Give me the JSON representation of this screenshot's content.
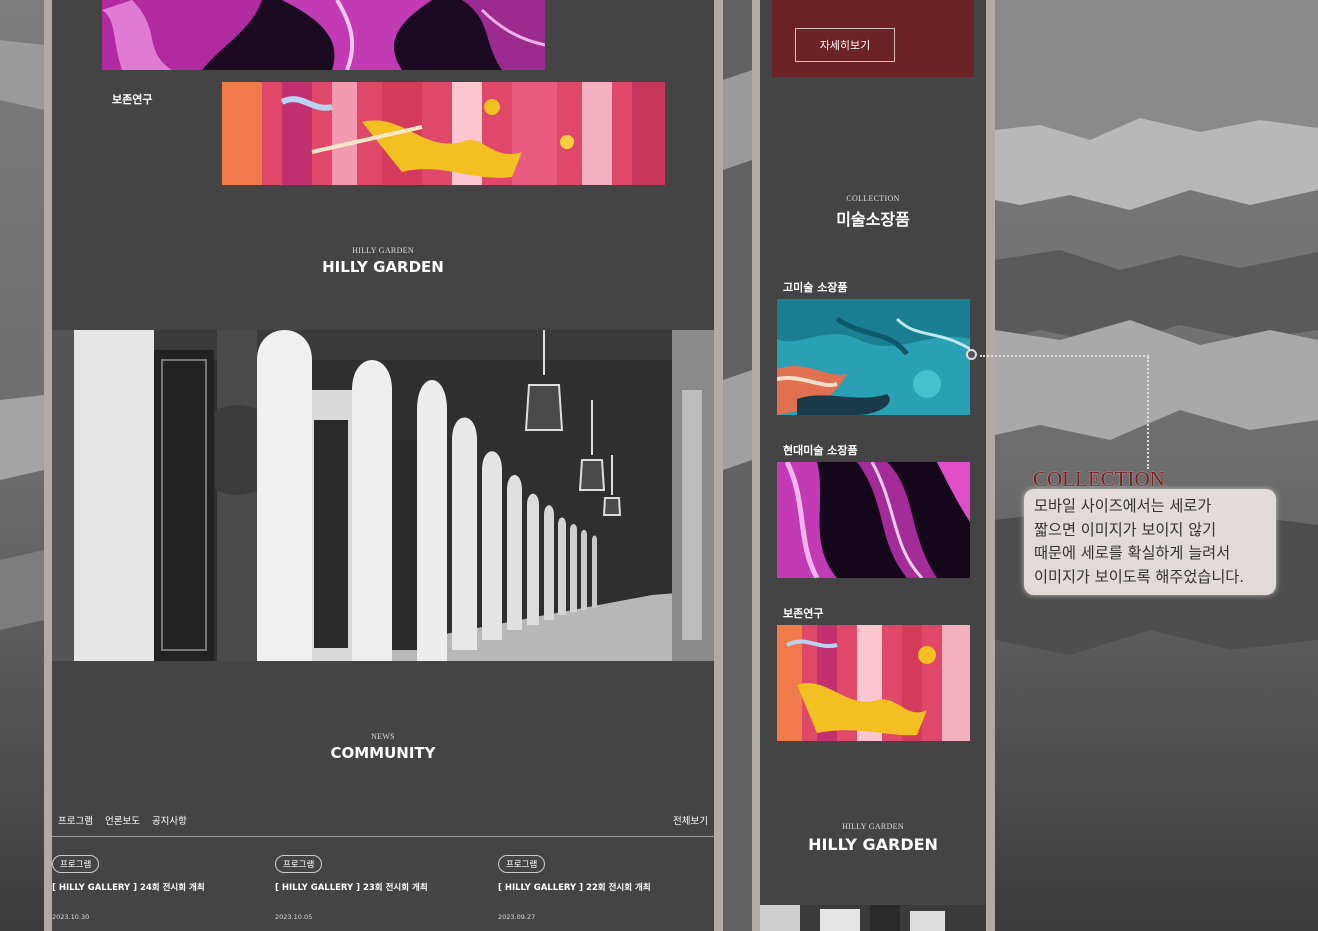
{
  "desktop": {
    "section_label_research": "보존연구",
    "hilly": {
      "eyebrow": "HILLY GARDEN",
      "title": "HILLY GARDEN"
    },
    "community": {
      "eyebrow": "NEWS",
      "title": "COMMUNITY"
    },
    "tabs": [
      "프로그램",
      "언론보도",
      "공지사항"
    ],
    "view_all": "전체보기",
    "news": [
      {
        "badge": "프로그램",
        "title": "[ HILLY GALLERY ] 24회 전시회 개최",
        "date": "2023.10.30"
      },
      {
        "badge": "프로그램",
        "title": "[ HILLY GALLERY ] 23회 전시회 개최",
        "date": "2023.10.05"
      },
      {
        "badge": "프로그램",
        "title": "[ HILLY GALLERY ] 22회 전시회 개최",
        "date": "2023.09.27"
      }
    ]
  },
  "mobile": {
    "detail_button": "자세히보기",
    "collection": {
      "eyebrow": "COLLECTION",
      "title": "미술소장품"
    },
    "items": [
      {
        "label": "고미술 소장품",
        "art": "teal-marble"
      },
      {
        "label": "현대미술 소장품",
        "art": "magenta-black-marble"
      },
      {
        "label": "보존연구",
        "art": "pink-yellow-abstract"
      }
    ],
    "hilly": {
      "eyebrow": "HILLY GARDEN",
      "title": "HILLY GARDEN"
    }
  },
  "callout": {
    "title": "COLLECTION",
    "lines": [
      "모바일 사이즈에서는 세로가",
      "짧으면 이미지가 보이지 않기",
      "때문에 세로를 확실하게 늘려서",
      "이미지가 보이도록 해주었습니다."
    ]
  },
  "colors": {
    "panel": "#444444",
    "frame": "#b3aaa8",
    "accent_red": "#6b2326",
    "callout_title": "#7a1f22"
  }
}
